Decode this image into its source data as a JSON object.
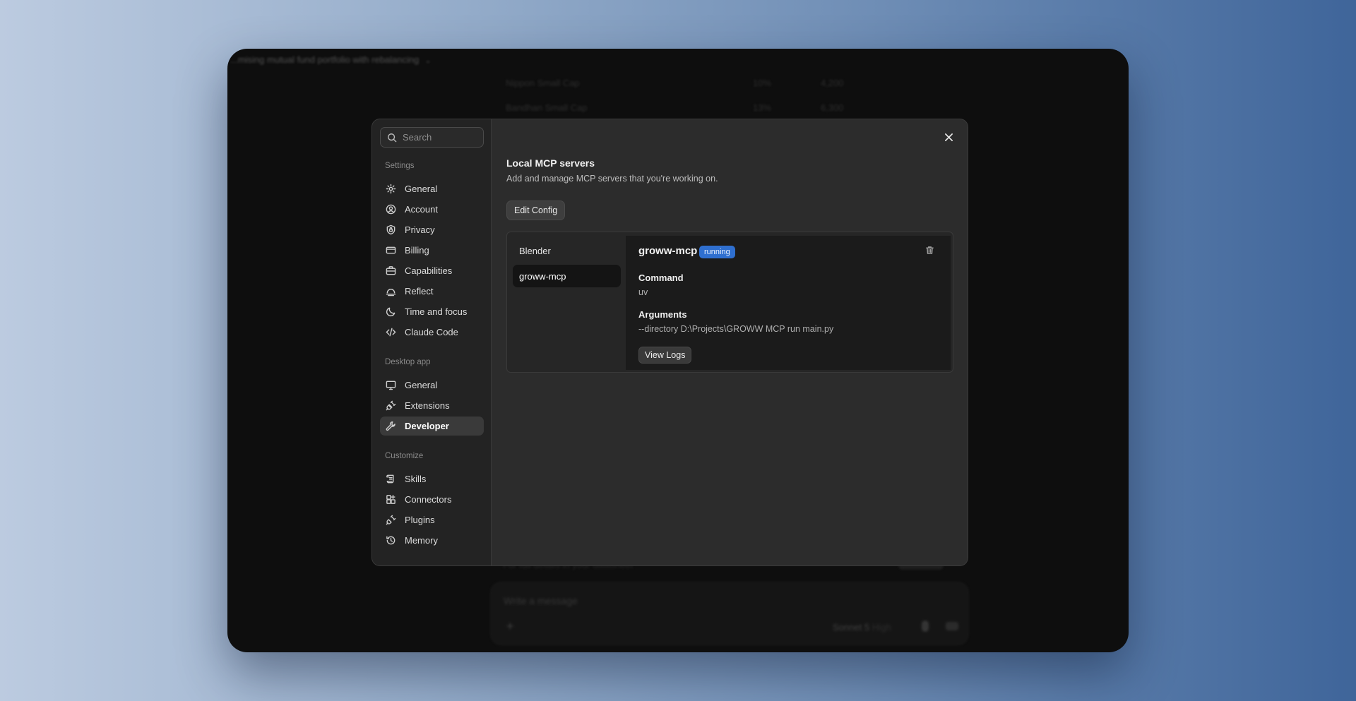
{
  "background_app": {
    "conversation_title": "...mising mutual fund portfolio with rebalancing",
    "table_rows": [
      {
        "name": "Nippon Small Cap",
        "pct": "10%",
        "amount": "4,200"
      },
      {
        "name": "Bandhan Small Cap",
        "pct": "13%",
        "amount": "6,300"
      }
    ],
    "note_text": "For full details in your datasheet",
    "composer": {
      "placeholder": "Write a message",
      "model_label": "Sonnet 5",
      "model_sub": "High"
    }
  },
  "settings": {
    "search": {
      "placeholder": "Search"
    },
    "sections": {
      "settings": "Settings",
      "desktop_app": "Desktop app",
      "customize": "Customize"
    },
    "nav": {
      "general": "General",
      "account": "Account",
      "privacy": "Privacy",
      "billing": "Billing",
      "capabilities": "Capabilities",
      "reflect": "Reflect",
      "time_focus": "Time and focus",
      "claude_code": "Claude Code",
      "desktop_general": "General",
      "extensions": "Extensions",
      "developer": "Developer",
      "skills": "Skills",
      "connectors": "Connectors",
      "plugins": "Plugins",
      "memory": "Memory"
    },
    "active_item": "Developer"
  },
  "developer": {
    "title": "Local MCP servers",
    "description": "Add and manage MCP servers that you're working on.",
    "edit_config_label": "Edit Config",
    "servers": [
      {
        "name": "Blender"
      },
      {
        "name": "groww-mcp"
      }
    ],
    "selected": {
      "name": "groww-mcp",
      "status": "running",
      "command_label": "Command",
      "command": "uv",
      "arguments_label": "Arguments",
      "arguments": "--directory D:\\Projects\\GROWW MCP run main.py",
      "view_logs_label": "View Logs"
    }
  },
  "colors": {
    "accent_badge": "#2f6fcf",
    "modal_bg": "#2c2c2c",
    "sidebar_bg": "#232323"
  }
}
